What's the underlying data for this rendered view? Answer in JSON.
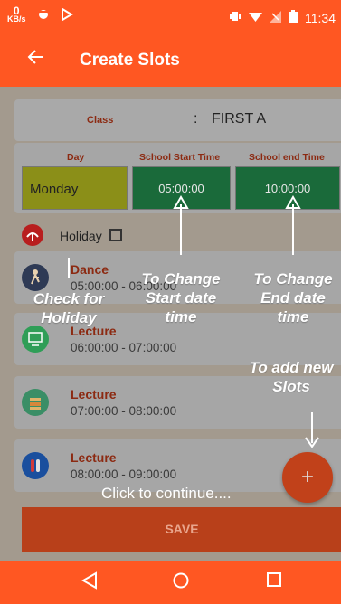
{
  "status_bar": {
    "network_speed_value": "0",
    "network_speed_unit": "KB/s",
    "time": "11:34"
  },
  "app_bar": {
    "back_icon": "arrow-left-icon",
    "title": "Create Slots"
  },
  "class_selector": {
    "label": "Class",
    "separator": ":",
    "value": "FIRST A"
  },
  "schedule_header": {
    "day_label": "Day",
    "start_label": "School Start Time",
    "end_label": "School end Time",
    "day_value": "Monday",
    "start_value": "05:00:00",
    "end_value": "10:00:00"
  },
  "holiday": {
    "label": "Holiday",
    "checked": false
  },
  "slots": [
    {
      "name": "Dance",
      "time": "05:00:00 - 06:00:00",
      "icon": "dance-icon"
    },
    {
      "name": "Lecture",
      "time": "06:00:00 - 07:00:00",
      "icon": "blackboard-icon"
    },
    {
      "name": "Lecture",
      "time": "07:00:00 - 08:00:00",
      "icon": "books-icon"
    },
    {
      "name": "Lecture",
      "time": "08:00:00 - 09:00:00",
      "icon": "test-tubes-icon"
    }
  ],
  "fab": {
    "label": "+"
  },
  "save_button": {
    "label": "SAVE"
  },
  "tutorial": {
    "holiday_hint": "Check for Holiday",
    "start_hint": "To Change Start date time",
    "end_hint": "To Change End date time",
    "add_hint": "To add new Slots",
    "continue_text": "Click to continue...."
  },
  "colors": {
    "primary": "#ff5722",
    "accent_text": "#8c2a12",
    "time_box": "#1a6a3a",
    "day_box": "#8b8f18"
  }
}
